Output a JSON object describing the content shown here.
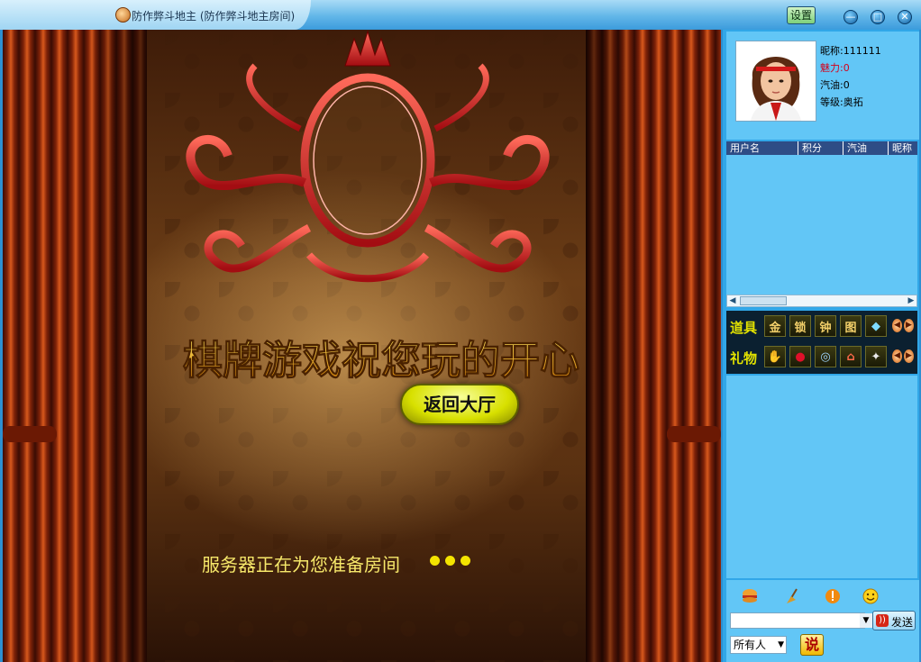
{
  "window": {
    "title": "防作弊斗地主 (防作弊斗地主房间)",
    "settings_label": "设置",
    "minimize_glyph": "—",
    "maximize_glyph": "□",
    "close_glyph": "✕"
  },
  "stage": {
    "headline": "棋牌游戏祝您玩的开心",
    "lobby_button": "返回大厅",
    "status": "服务器正在为您准备房间"
  },
  "profile": {
    "nickname": "昵称:111111",
    "charm": "魅力:0",
    "gas": "汽油:0",
    "level": "等级:奥拓"
  },
  "player_table": {
    "columns": [
      "用户名",
      "积分",
      "汽油",
      "昵称"
    ]
  },
  "itembar": {
    "props_label": "道具",
    "gifts_label": "礼物",
    "props": [
      {
        "icon": "gold-card-icon",
        "glyph": "金"
      },
      {
        "icon": "lock-card-icon",
        "glyph": "锁"
      },
      {
        "icon": "clock-card-icon",
        "glyph": "钟"
      },
      {
        "icon": "picture-card-icon",
        "glyph": "图"
      },
      {
        "icon": "diamond-icon",
        "glyph": "◆"
      }
    ],
    "gifts": [
      {
        "icon": "hand-icon",
        "glyph": "✋"
      },
      {
        "icon": "lips-icon",
        "glyph": "●"
      },
      {
        "icon": "car-icon",
        "glyph": "◎"
      },
      {
        "icon": "house-icon",
        "glyph": "⌂"
      },
      {
        "icon": "cat-icon",
        "glyph": "✦"
      }
    ]
  },
  "chat": {
    "send_label": "发送",
    "target": "所有人",
    "speak_glyph": "说",
    "input_value": ""
  },
  "colors": {
    "panel_bg": "#31a7e8",
    "panel_light": "#62c6f6",
    "header_dark": "#2e4d86",
    "gold_text": "#f7e86a"
  }
}
